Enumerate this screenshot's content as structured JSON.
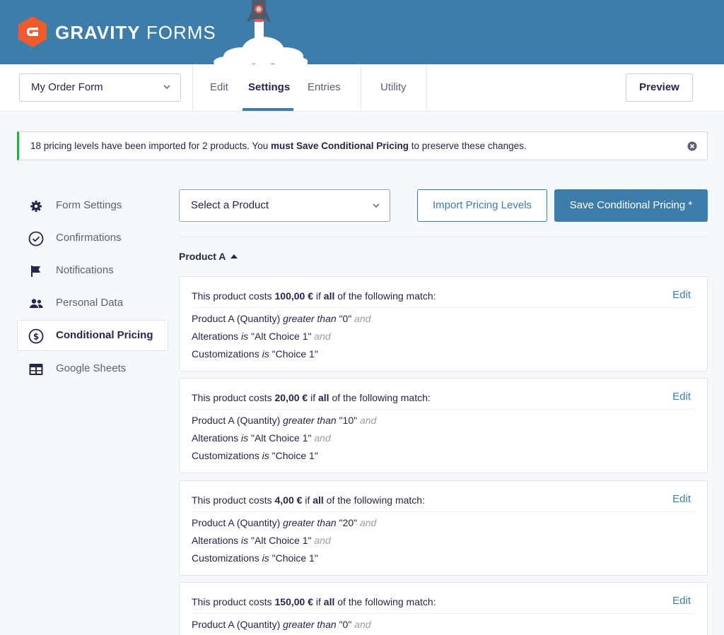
{
  "header": {
    "brand_bold": "GRAVITY",
    "brand_light": "FORMS",
    "colors": {
      "header_bg": "#3e7daa",
      "logo": "#f15a2b"
    }
  },
  "toolbar": {
    "form_select_value": "My Order Form",
    "tabs": [
      {
        "label": "Edit",
        "active": false
      },
      {
        "label": "Settings",
        "active": true
      },
      {
        "label": "Entries",
        "active": false
      },
      {
        "label": "Utility",
        "active": false
      }
    ],
    "preview_label": "Preview"
  },
  "notice": {
    "text_before": "18 pricing levels have been imported for 2 products. You ",
    "text_bold": "must Save Conditional Pricing",
    "text_after": " to preserve these changes.",
    "border_color": "#24ab49"
  },
  "sidebar": {
    "items": [
      {
        "label": "Form Settings",
        "icon": "gear-icon",
        "active": false
      },
      {
        "label": "Confirmations",
        "icon": "check-circle-icon",
        "active": false
      },
      {
        "label": "Notifications",
        "icon": "flag-icon",
        "active": false
      },
      {
        "label": "Personal Data",
        "icon": "users-icon",
        "active": false
      },
      {
        "label": "Conditional Pricing",
        "icon": "dollar-circle-icon",
        "active": true
      },
      {
        "label": "Google Sheets",
        "icon": "table-icon",
        "active": false
      }
    ]
  },
  "main": {
    "product_select_value": "Select a Product",
    "import_label": "Import Pricing Levels",
    "save_label": "Save Conditional Pricing *",
    "section_title": "Product A",
    "rules": [
      {
        "prefix": "This product costs ",
        "price": "100,00 €",
        "mid": " if ",
        "match": "all",
        "suffix": " of the following match:",
        "edit": "Edit",
        "conditions": [
          {
            "field": "Product A (Quantity) ",
            "op": "greater than",
            "value": " \"0\"",
            "joiner": " and"
          },
          {
            "field": "Alterations ",
            "op": "is",
            "value": " \"Alt Choice 1\"",
            "joiner": " and"
          },
          {
            "field": "Customizations ",
            "op": "is",
            "value": " \"Choice 1\"",
            "joiner": ""
          }
        ]
      },
      {
        "prefix": "This product costs ",
        "price": "20,00 €",
        "mid": " if ",
        "match": "all",
        "suffix": " of the following match:",
        "edit": "Edit",
        "conditions": [
          {
            "field": "Product A (Quantity) ",
            "op": "greater than",
            "value": " \"10\"",
            "joiner": " and"
          },
          {
            "field": "Alterations ",
            "op": "is",
            "value": " \"Alt Choice 1\"",
            "joiner": " and"
          },
          {
            "field": "Customizations ",
            "op": "is",
            "value": " \"Choice 1\"",
            "joiner": ""
          }
        ]
      },
      {
        "prefix": "This product costs ",
        "price": "4,00 €",
        "mid": " if ",
        "match": "all",
        "suffix": " of the following match:",
        "edit": "Edit",
        "conditions": [
          {
            "field": "Product A (Quantity) ",
            "op": "greater than",
            "value": " \"20\"",
            "joiner": " and"
          },
          {
            "field": "Alterations ",
            "op": "is",
            "value": " \"Alt Choice 1\"",
            "joiner": " and"
          },
          {
            "field": "Customizations ",
            "op": "is",
            "value": " \"Choice 1\"",
            "joiner": ""
          }
        ]
      },
      {
        "prefix": "This product costs ",
        "price": "150,00 €",
        "mid": " if ",
        "match": "all",
        "suffix": " of the following match:",
        "edit": "Edit",
        "conditions": [
          {
            "field": "Product A (Quantity) ",
            "op": "greater than",
            "value": " \"0\"",
            "joiner": " and"
          }
        ]
      }
    ]
  }
}
